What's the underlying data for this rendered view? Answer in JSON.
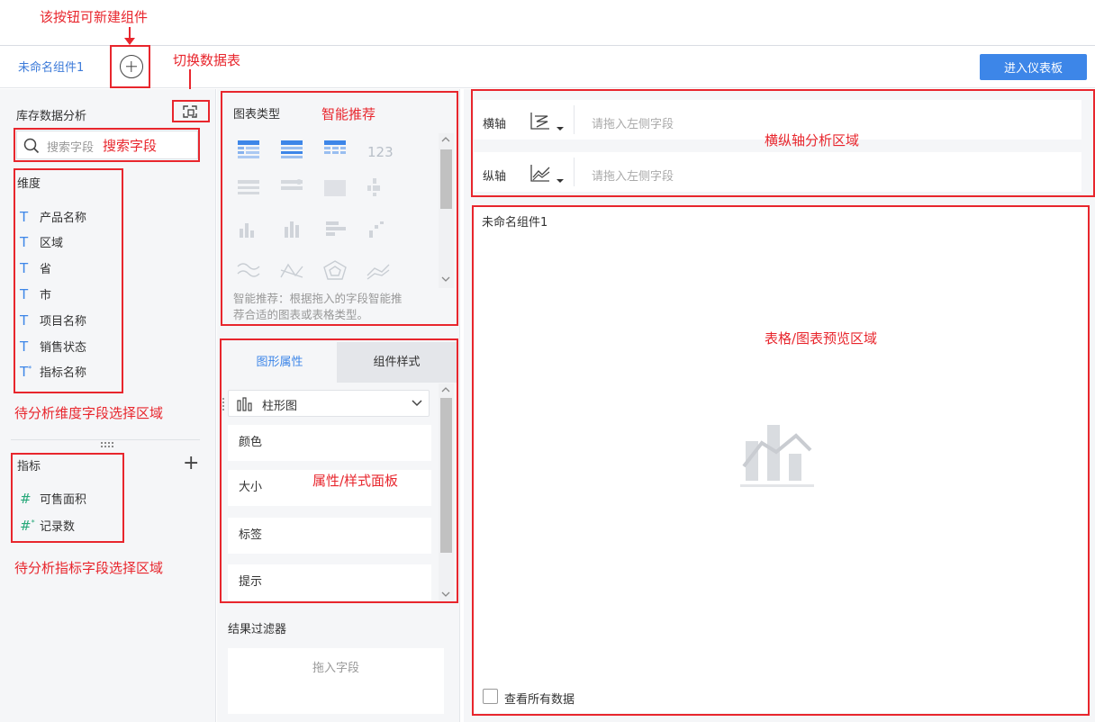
{
  "annotations": {
    "new_component": "该按钮可新建组件",
    "switch_table": "切换数据表",
    "search_field": "搜索字段",
    "dimension_area": "待分析维度字段选择区域",
    "metric_area": "待分析指标字段选择区域",
    "smart_recommend": "智能推荐",
    "property_panel": "属性/样式面板",
    "axis_area": "横纵轴分析区域",
    "preview_area": "表格/图表预览区域"
  },
  "tabs": {
    "active": "未命名组件1"
  },
  "header": {
    "dashboard_button": "进入仪表板"
  },
  "left": {
    "dataset_title": "库存数据分析",
    "search_placeholder": "搜索字段",
    "dimension_title": "维度",
    "dimensions": [
      "产品名称",
      "区域",
      "省",
      "市",
      "项目名称",
      "销售状态",
      "指标名称"
    ],
    "metric_title": "指标",
    "metrics": [
      "可售面积",
      "记录数"
    ]
  },
  "mid": {
    "chart_type_title": "图表类型",
    "smart_tip_line1": "智能推荐：根据拖入的字段智能推",
    "smart_tip_line2": "荐合适的图表或表格类型。",
    "tab_graph": "图形属性",
    "tab_style": "组件样式",
    "chart_select": "柱形图",
    "props": [
      "颜色",
      "大小",
      "标签",
      "提示"
    ],
    "filter_title": "结果过滤器",
    "filter_drop": "拖入字段"
  },
  "axes": {
    "x_label": "横轴",
    "y_label": "纵轴",
    "x_placeholder": "请拖入左侧字段",
    "y_placeholder": "请拖入左侧字段"
  },
  "preview": {
    "title": "未命名组件1",
    "view_all": "查看所有数据"
  },
  "colors": {
    "accent": "#3d86e8",
    "annotation": "#e8262d"
  }
}
